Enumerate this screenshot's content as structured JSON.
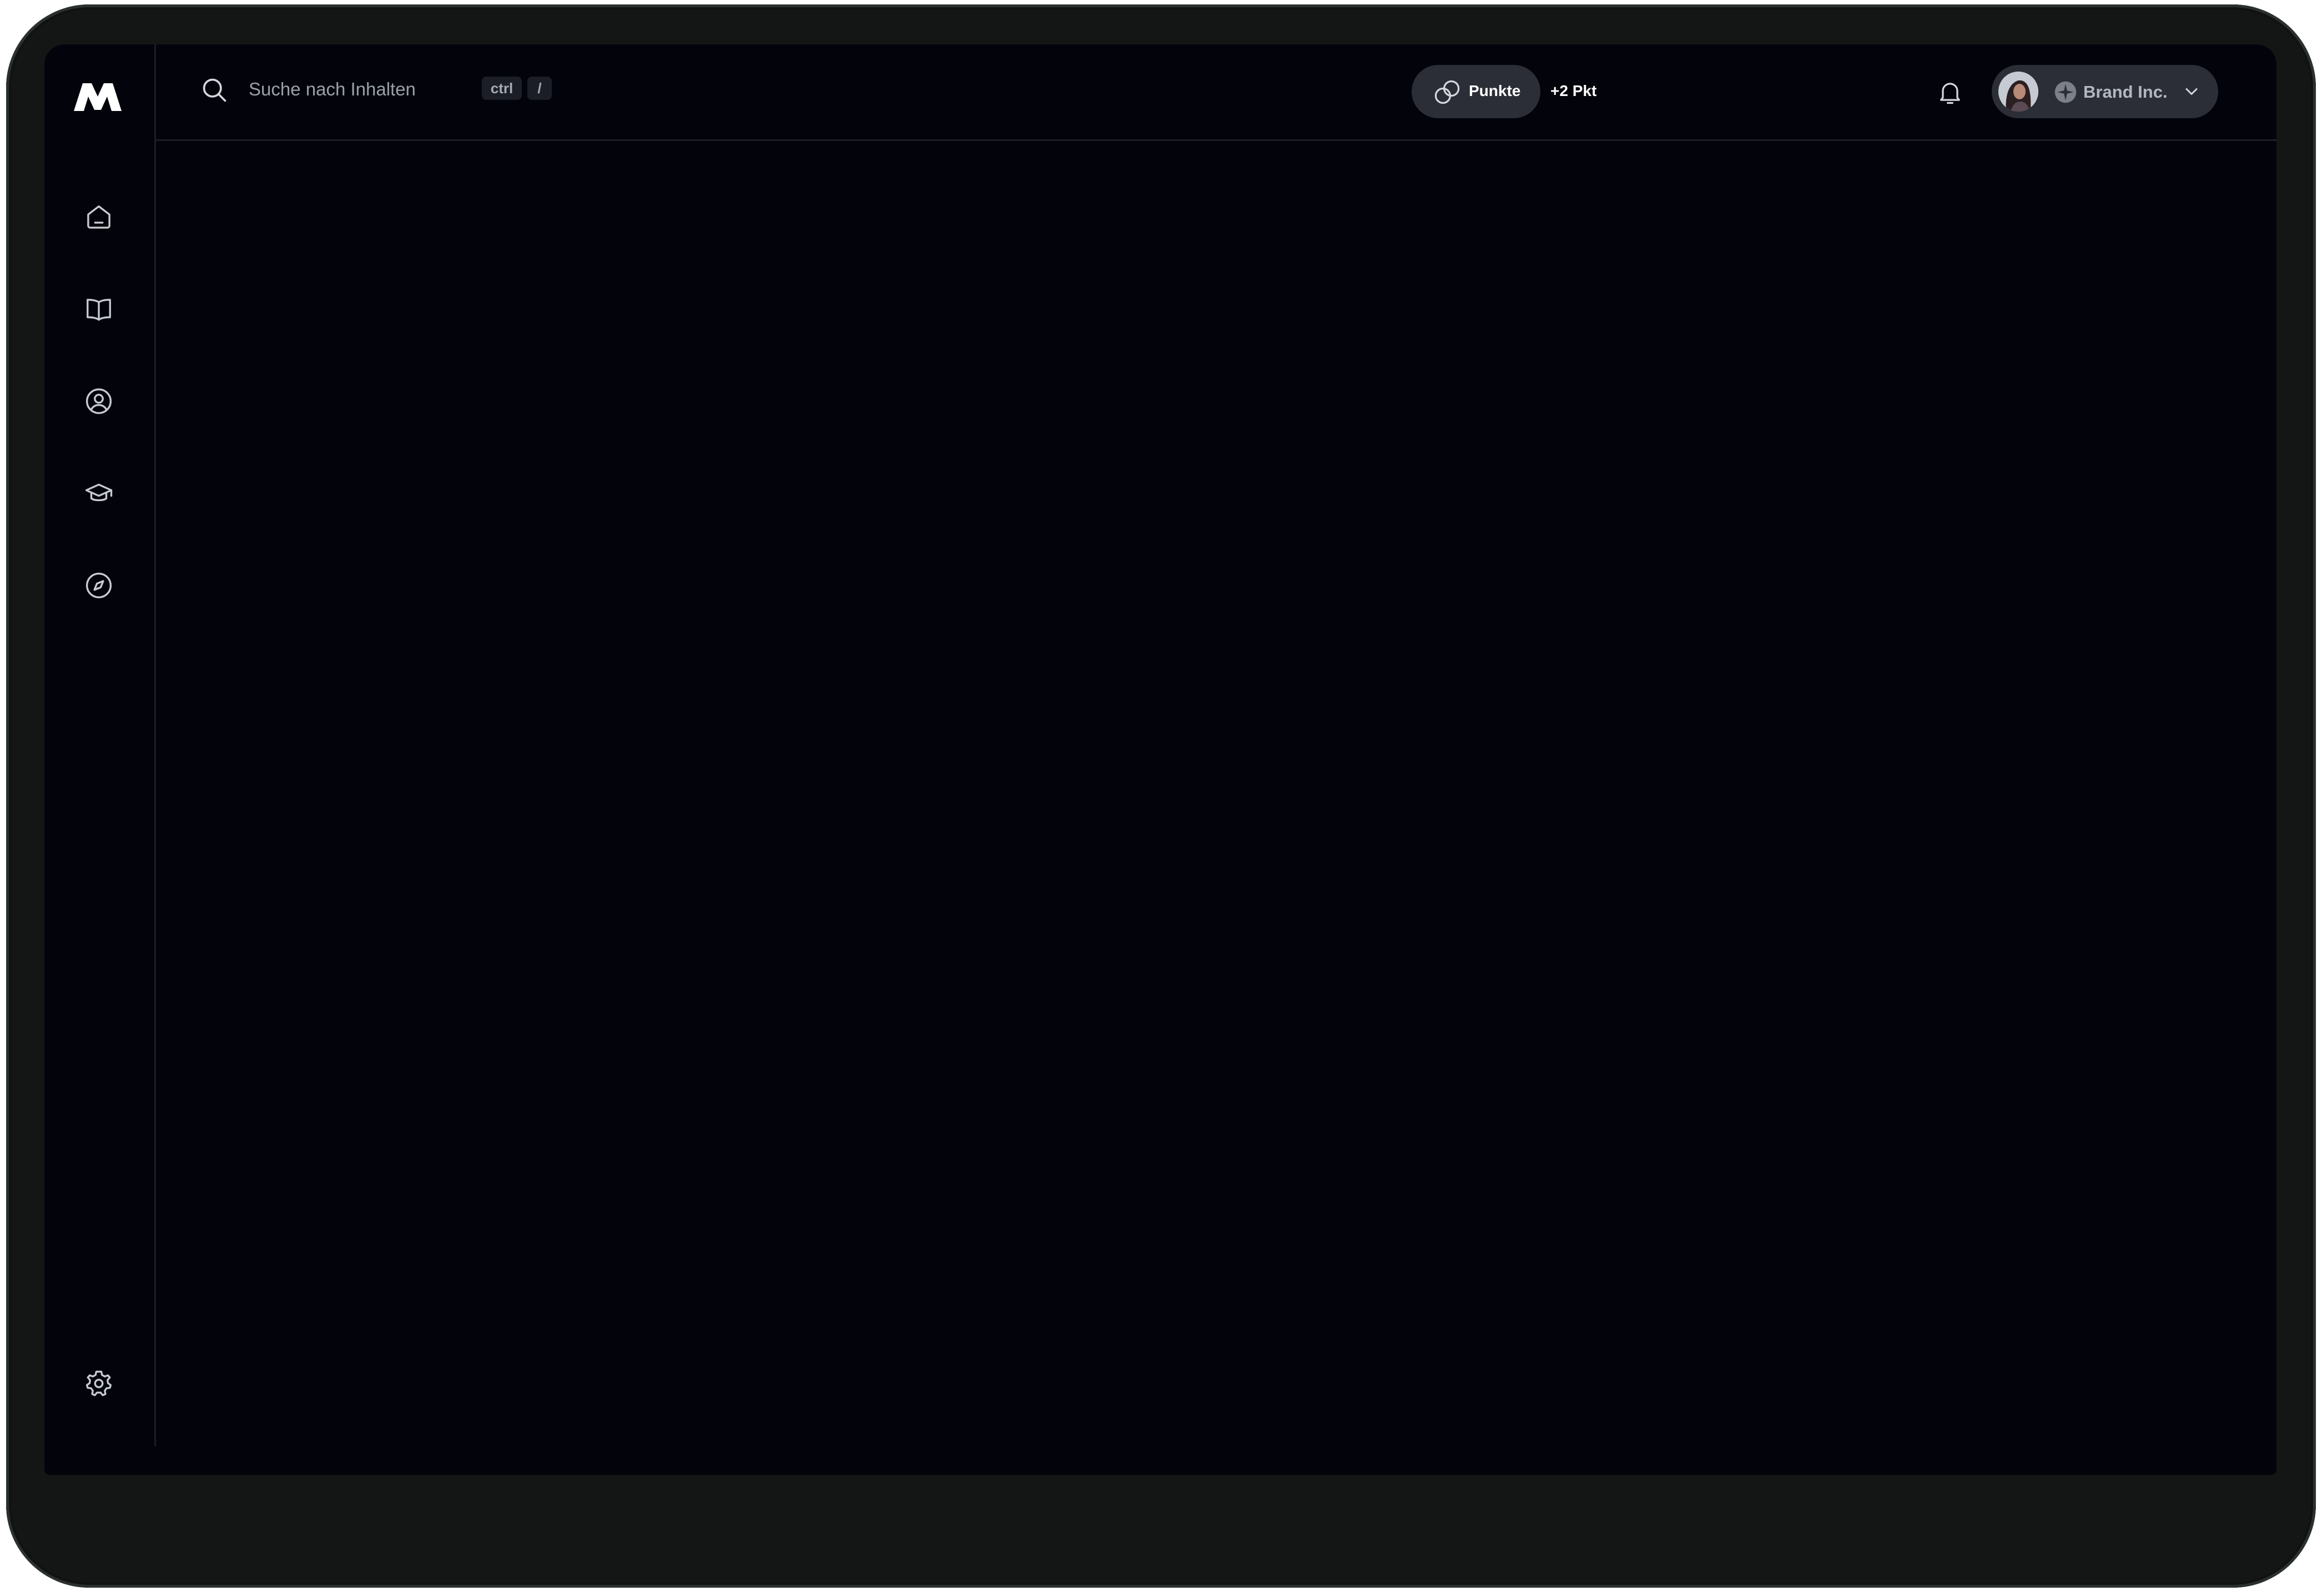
{
  "colors": {
    "background": "#03040b",
    "frame": "#141615",
    "pill": "#2b2e36",
    "icon": "#c6cad1"
  },
  "sidebar": {
    "logo": "m-logo",
    "items": [
      {
        "name": "home",
        "icon": "home-icon"
      },
      {
        "name": "library",
        "icon": "book-open-icon"
      },
      {
        "name": "profile",
        "icon": "user-circle-icon"
      },
      {
        "name": "courses",
        "icon": "graduation-cap-icon"
      },
      {
        "name": "explore",
        "icon": "compass-icon"
      }
    ],
    "footer": {
      "name": "settings",
      "icon": "gear-icon"
    }
  },
  "header": {
    "search": {
      "placeholder": "Suche nach  Inhalten",
      "shortcut_keys": [
        "ctrl",
        "/"
      ]
    },
    "points": {
      "label": "Punkte",
      "delta": "+2 Pkt"
    },
    "notifications_icon": "bell-icon",
    "account": {
      "name": "Brand Inc.",
      "icon": "brand-star-icon"
    }
  }
}
